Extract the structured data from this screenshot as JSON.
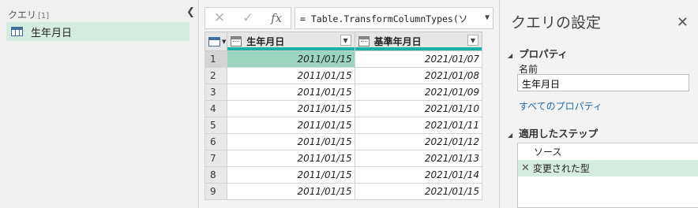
{
  "queries": {
    "header": "クエリ",
    "count": "[1]",
    "items": [
      {
        "label": "生年月日"
      }
    ]
  },
  "formula_bar": {
    "cancel_glyph": "✕",
    "commit_glyph": "✓",
    "fx_label": "fx",
    "formula_text": "= Table.TransformColumnTypes(ソ"
  },
  "grid": {
    "columns": [
      {
        "name": "生年月日"
      },
      {
        "name": "基準年月日"
      }
    ],
    "rows": [
      {
        "n": "1",
        "c1": "2011/01/15",
        "c2": "2021/01/07"
      },
      {
        "n": "2",
        "c1": "2011/01/15",
        "c2": "2021/01/08"
      },
      {
        "n": "3",
        "c1": "2011/01/15",
        "c2": "2021/01/09"
      },
      {
        "n": "4",
        "c1": "2011/01/15",
        "c2": "2021/01/10"
      },
      {
        "n": "5",
        "c1": "2011/01/15",
        "c2": "2021/01/11"
      },
      {
        "n": "6",
        "c1": "2011/01/15",
        "c2": "2021/01/12"
      },
      {
        "n": "7",
        "c1": "2011/01/15",
        "c2": "2021/01/13"
      },
      {
        "n": "8",
        "c1": "2011/01/15",
        "c2": "2021/01/14"
      },
      {
        "n": "9",
        "c1": "2011/01/15",
        "c2": "2021/01/15"
      }
    ]
  },
  "settings": {
    "title": "クエリの設定",
    "properties_header": "プロパティ",
    "name_label": "名前",
    "name_value": "生年月日",
    "all_properties_link": "すべてのプロパティ",
    "steps_header": "適用したステップ",
    "steps": [
      {
        "label": "ソース"
      },
      {
        "label": "変更された型"
      }
    ]
  },
  "colors": {
    "accent_teal": "#18b3a5",
    "selection_green": "#d5ece0",
    "selected_cell": "#9bd5bf",
    "link_blue": "#1e6aa8"
  }
}
